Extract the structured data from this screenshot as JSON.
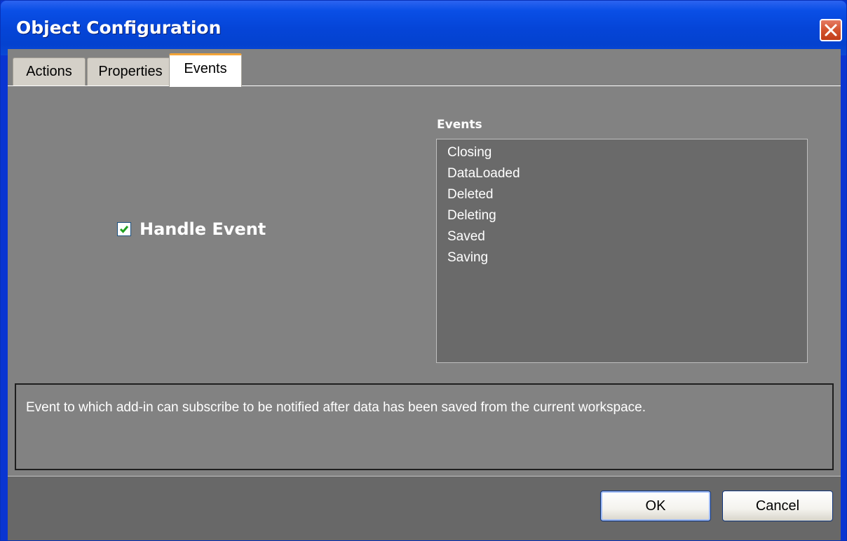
{
  "window": {
    "title": "Object Configuration",
    "colors": {
      "titlebar": "#0545d8",
      "client": "#828282",
      "listbox": "#6a6a6a",
      "tab_accent": "#f3a437"
    }
  },
  "tabs": [
    {
      "label": "Actions",
      "active": false
    },
    {
      "label": "Properties",
      "active": false
    },
    {
      "label": "Events",
      "active": true
    }
  ],
  "handle_event": {
    "label": "Handle Event",
    "checked": true
  },
  "events_list": {
    "heading": "Events",
    "items": [
      "Closing",
      "DataLoaded",
      "Deleted",
      "Deleting",
      "Saved",
      "Saving"
    ]
  },
  "description": "Event to which add-in can subscribe to be notified after data has been saved from the current workspace.",
  "buttons": {
    "ok": "OK",
    "cancel": "Cancel"
  },
  "icons": {
    "close": "close-icon",
    "check": "checkmark-icon"
  }
}
